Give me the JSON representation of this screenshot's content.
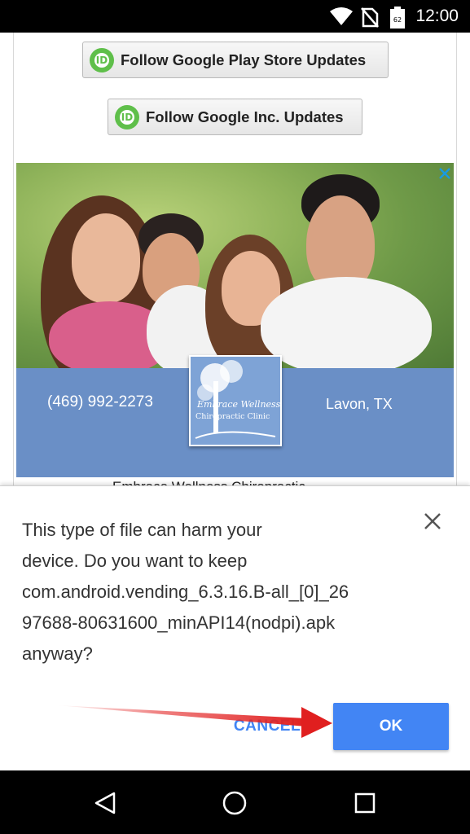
{
  "status_bar": {
    "time": "12:00",
    "icons": [
      "wifi-icon",
      "no-sim-icon",
      "battery-icon"
    ]
  },
  "follow_buttons": [
    {
      "label": "Follow Google Play Store Updates",
      "icon": "id-logo-icon"
    },
    {
      "label": "Follow Google Inc. Updates",
      "icon": "id-logo-icon"
    }
  ],
  "ad": {
    "phone": "(469) 992-2273",
    "location": "Lavon, TX",
    "logo_script": "Embrace Wellness",
    "logo_clinic": "Chiropractic Clinic",
    "caption": "Embrace Wellness Chiropractic",
    "close_icon": "close-x-icon"
  },
  "dialog": {
    "message_lines": [
      "This type of file can harm your",
      "device. Do you want to keep",
      "com.android.vending_6.3.16.B-all_[0]_26",
      "97688-80631600_minAPI14(nodpi).apk",
      "anyway?"
    ],
    "cancel_label": "CANCEL",
    "ok_label": "OK",
    "accent": "#4285f4"
  },
  "nav_bar": {
    "icons": [
      "back-icon",
      "home-icon",
      "recents-icon"
    ]
  }
}
